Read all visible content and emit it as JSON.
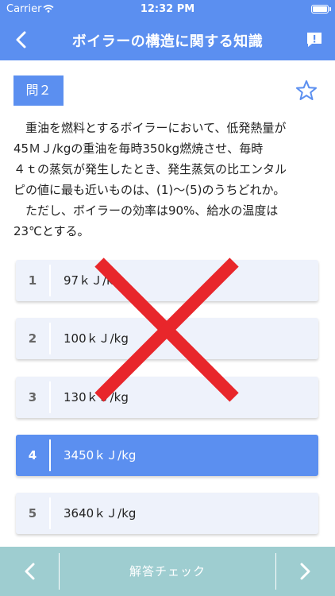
{
  "status_bar": {
    "carrier": "Carrier",
    "time": "12:32 PM"
  },
  "nav": {
    "title": "ボイラーの構造に関する知識"
  },
  "question": {
    "badge": "問２",
    "lines": [
      "　重油を燃料とするボイラーにおいて、低発熱量が",
      "45ＭＪ/kgの重油を毎時350kg燃焼させ、毎時",
      "４ｔの蒸気が発生したとき、発生蒸気の比エンタル",
      "ピの値に最も近いものは、(1)〜(5)のうちどれか。",
      "　ただし、ボイラーの効率は90%、給水の温度は",
      "23℃とする。"
    ]
  },
  "choices": [
    {
      "number": "1",
      "text": "97ｋＪ/kg"
    },
    {
      "number": "2",
      "text": "100ｋＪ/kg"
    },
    {
      "number": "3",
      "text": "130ｋＪ/kg"
    },
    {
      "number": "4",
      "text": "3450ｋＪ/kg"
    },
    {
      "number": "5",
      "text": "3640ｋＪ/kg"
    }
  ],
  "selected_choice": "4",
  "result_mark": "incorrect-cross-icon",
  "bottom": {
    "check_label": "解答チェック"
  },
  "colors": {
    "primary": "#5b8ff0",
    "choice_bg": "#eef2fb",
    "cross": "#e8262b",
    "bottom_bar": "#9ecdd0"
  }
}
